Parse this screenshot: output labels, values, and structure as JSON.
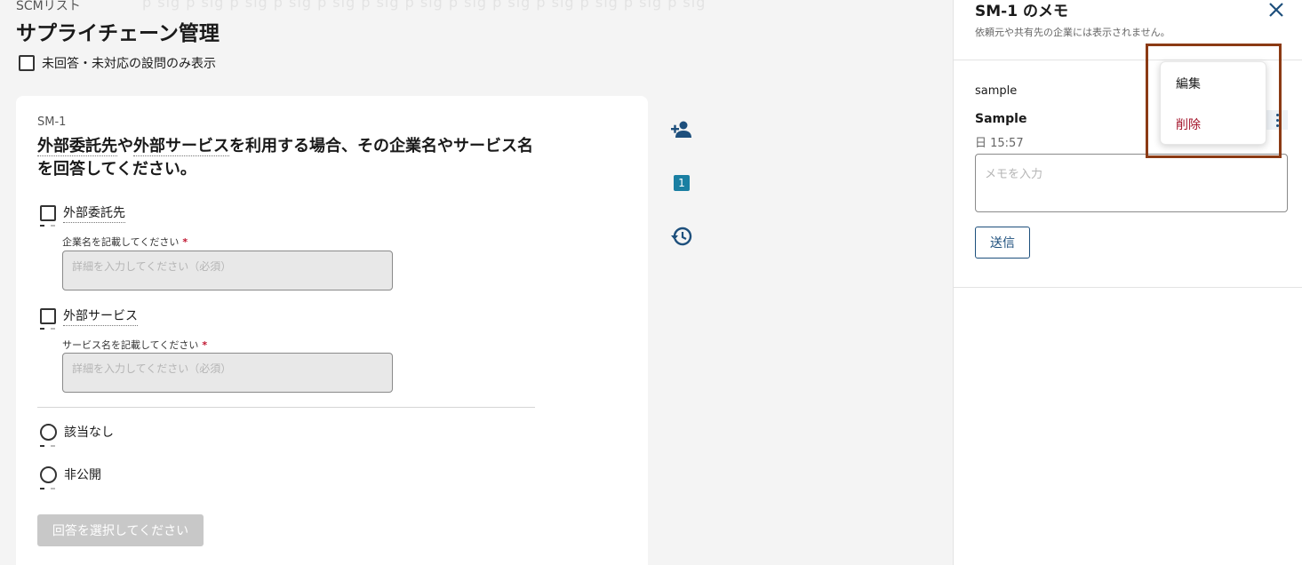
{
  "header": {
    "breadcrumb": "SCMリスト",
    "title": "サプライチェーン管理",
    "watermark": "p sig p sig p sig p sig p sig p sig p sig p sig p sig p sig p sig p sig p sig"
  },
  "filter": {
    "label": "未回答・未対応の設問のみ表示",
    "checked": false
  },
  "question": {
    "id": "SM-1",
    "text_part1": "外部委託先",
    "text_part2": "や",
    "text_part3": "外部サービス",
    "text_part4": "を利用する場合、その企業名やサービス名を回答してください。",
    "options": [
      {
        "label": "外部委託先",
        "type": "checkbox",
        "field_label": "企業名を記載してください",
        "placeholder": "詳細を入力してください（必須）"
      },
      {
        "label": "外部サービス",
        "type": "checkbox",
        "field_label": "サービス名を記載してください",
        "placeholder": "詳細を入力してください（必須）"
      },
      {
        "label": "該当なし",
        "type": "radio"
      },
      {
        "label": "非公開",
        "type": "radio"
      }
    ],
    "required_mark": "*",
    "select_button": "回答を選択してください"
  },
  "side": {
    "memo_count": "1"
  },
  "panel": {
    "title": "SM-1 のメモ",
    "subtitle": "依頼元や共有先の企業には表示されません。",
    "memo": {
      "body": "sample",
      "author": "Sample",
      "time": "日 15:57"
    },
    "input_placeholder": "メモを入力",
    "send_label": "送信"
  },
  "menu": {
    "edit": "編集",
    "delete": "削除"
  },
  "colors": {
    "accent": "#1d4f7c",
    "danger": "#a3132a",
    "badge": "#1a7fa2",
    "highlight": "#8b3a14"
  }
}
